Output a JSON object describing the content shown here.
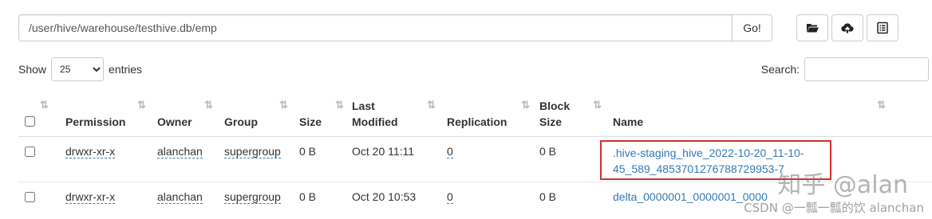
{
  "path": {
    "value": "/user/hive/warehouse/testhive.db/emp",
    "go_label": "Go!"
  },
  "toolbar": {
    "icons": [
      "folder-open-icon",
      "cloud-upload-icon",
      "list-alt-icon"
    ]
  },
  "show": {
    "prefix": "Show",
    "selected": "25",
    "suffix": "entries"
  },
  "search": {
    "label": "Search:"
  },
  "table": {
    "headers": {
      "permission": "Permission",
      "owner": "Owner",
      "group": "Group",
      "size": "Size",
      "last_modified_1": "Last",
      "last_modified_2": "Modified",
      "replication": "Replication",
      "block_size_1": "Block",
      "block_size_2": "Size",
      "name": "Name"
    },
    "rows": [
      {
        "permission": "drwxr-xr-x",
        "owner": "alanchan",
        "group": "supergroup",
        "size": "0 B",
        "modified": "Oct 20 11:11",
        "replication": "0",
        "block_size": "0 B",
        "name_line1": ".hive-staging_hive_2022-10-20_11-10-",
        "name_line2": "45_589_4853701276788729953-7",
        "highlight": "#d0312d"
      },
      {
        "permission": "drwxr-xr-x",
        "owner": "alanchan",
        "group": "supergroup",
        "size": "0 B",
        "modified": "Oct 20 10:53",
        "replication": "0",
        "block_size": "0 B",
        "name_line1": "delta_0000001_0000001_0000"
      }
    ]
  },
  "watermark": {
    "line1": "知乎 @alan",
    "line2": "CSDN @一瓢一瓢的饮 alanchan"
  },
  "colors": {
    "link": "#337ab7",
    "highlight_border": "#d0312d"
  }
}
